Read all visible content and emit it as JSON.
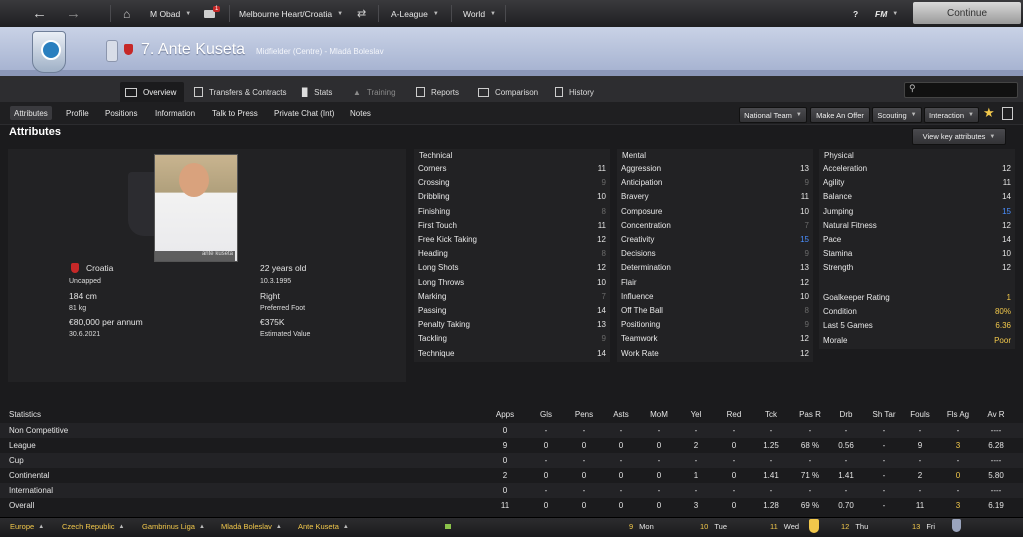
{
  "topbar": {
    "manager": "M Obad",
    "mail_count": "1",
    "club": "Melbourne Heart/Croatia",
    "competition": "A-League",
    "world": "World",
    "help": "?",
    "fm": "FM",
    "continue": "Continue"
  },
  "player": {
    "title": "7. Ante Kuseta",
    "subtitle": "Midfielder (Centre) - Mladá Boleslav",
    "photo_caption": "ante kuseta",
    "nation": "Croatia",
    "age": "22 years old",
    "caps": "Uncapped",
    "dob": "10.3.1995",
    "height": "184 cm",
    "foot": "Right",
    "weight": "81 kg",
    "foot_label": "Preferred Foot",
    "wage": "€80,000 per annum",
    "value": "€375K",
    "contract": "30.6.2021",
    "value_label": "Estimated Value"
  },
  "tabs": [
    {
      "label": "Overview"
    },
    {
      "label": "Transfers & Contracts"
    },
    {
      "label": "Stats"
    },
    {
      "label": "Training"
    },
    {
      "label": "Reports"
    },
    {
      "label": "Comparison"
    },
    {
      "label": "History"
    }
  ],
  "subnav": [
    "Attributes",
    "Profile",
    "Positions",
    "Information",
    "Talk to Press",
    "Private Chat (Int)",
    "Notes"
  ],
  "actions": {
    "national_team": "National Team",
    "make_offer": "Make An Offer",
    "scouting": "Scouting",
    "interaction": "Interaction",
    "view_key": "View key attributes"
  },
  "section_title": "Attributes",
  "colors": {
    "accent": "#f2c84b",
    "highlight": "#4a8fff",
    "low": "#6a6a6a"
  },
  "technical": {
    "header": "Technical",
    "items": [
      {
        "label": "Corners",
        "value": "11"
      },
      {
        "label": "Crossing",
        "value": "9"
      },
      {
        "label": "Dribbling",
        "value": "10"
      },
      {
        "label": "Finishing",
        "value": "8"
      },
      {
        "label": "First Touch",
        "value": "11"
      },
      {
        "label": "Free Kick Taking",
        "value": "12"
      },
      {
        "label": "Heading",
        "value": "8"
      },
      {
        "label": "Long Shots",
        "value": "12"
      },
      {
        "label": "Long Throws",
        "value": "10"
      },
      {
        "label": "Marking",
        "value": "7"
      },
      {
        "label": "Passing",
        "value": "14"
      },
      {
        "label": "Penalty Taking",
        "value": "13"
      },
      {
        "label": "Tackling",
        "value": "9"
      },
      {
        "label": "Technique",
        "value": "14"
      }
    ]
  },
  "mental": {
    "header": "Mental",
    "items": [
      {
        "label": "Aggression",
        "value": "13"
      },
      {
        "label": "Anticipation",
        "value": "9"
      },
      {
        "label": "Bravery",
        "value": "11"
      },
      {
        "label": "Composure",
        "value": "10"
      },
      {
        "label": "Concentration",
        "value": "7"
      },
      {
        "label": "Creativity",
        "value": "15"
      },
      {
        "label": "Decisions",
        "value": "9"
      },
      {
        "label": "Determination",
        "value": "13"
      },
      {
        "label": "Flair",
        "value": "12"
      },
      {
        "label": "Influence",
        "value": "10"
      },
      {
        "label": "Off The Ball",
        "value": "8"
      },
      {
        "label": "Positioning",
        "value": "9"
      },
      {
        "label": "Teamwork",
        "value": "12"
      },
      {
        "label": "Work Rate",
        "value": "12"
      }
    ]
  },
  "physical": {
    "header": "Physical",
    "items": [
      {
        "label": "Acceleration",
        "value": "12"
      },
      {
        "label": "Agility",
        "value": "11"
      },
      {
        "label": "Balance",
        "value": "14"
      },
      {
        "label": "Jumping",
        "value": "15"
      },
      {
        "label": "Natural Fitness",
        "value": "12"
      },
      {
        "label": "Pace",
        "value": "14"
      },
      {
        "label": "Stamina",
        "value": "10"
      },
      {
        "label": "Strength",
        "value": "12"
      }
    ],
    "extra": [
      {
        "label": "Goalkeeper Rating",
        "value": "1"
      },
      {
        "label": "Condition",
        "value": "80%"
      },
      {
        "label": "Last 5 Games",
        "value": "6.36"
      },
      {
        "label": "Morale",
        "value": "Poor"
      }
    ]
  },
  "stats": {
    "header": "Statistics",
    "columns": [
      "Apps",
      "Gls",
      "Pens",
      "Asts",
      "MoM",
      "Yel",
      "Red",
      "Tck",
      "Pas R",
      "Drb",
      "Sh Tar",
      "Fouls",
      "Fls Ag",
      "Av R"
    ],
    "rows": [
      {
        "label": "Non Competitive",
        "values": [
          "0",
          "-",
          "-",
          "-",
          "-",
          "-",
          "-",
          "-",
          "-",
          "-",
          "-",
          "-",
          "-",
          "----"
        ]
      },
      {
        "label": "League",
        "values": [
          "9",
          "0",
          "0",
          "0",
          "0",
          "2",
          "0",
          "1.25",
          "68 %",
          "0.56",
          "-",
          "9",
          "3",
          "6.28"
        ]
      },
      {
        "label": "Cup",
        "values": [
          "0",
          "-",
          "-",
          "-",
          "-",
          "-",
          "-",
          "-",
          "-",
          "-",
          "-",
          "-",
          "-",
          "----"
        ]
      },
      {
        "label": "Continental",
        "values": [
          "2",
          "0",
          "0",
          "0",
          "0",
          "1",
          "0",
          "1.41",
          "71 %",
          "1.41",
          "-",
          "2",
          "0",
          "5.80"
        ]
      },
      {
        "label": "International",
        "values": [
          "0",
          "-",
          "-",
          "-",
          "-",
          "-",
          "-",
          "-",
          "-",
          "-",
          "-",
          "-",
          "-",
          "----"
        ]
      },
      {
        "label": "Overall",
        "values": [
          "11",
          "0",
          "0",
          "0",
          "0",
          "3",
          "0",
          "1.28",
          "69 %",
          "0.70",
          "-",
          "11",
          "3",
          "6.19"
        ]
      }
    ]
  },
  "footer": {
    "crumbs": [
      "Europe",
      "Czech Republic",
      "Gambrinus Liga",
      "Mladá Boleslav",
      "Ante Kuseta"
    ],
    "days": [
      {
        "num": "9",
        "day": "Mon"
      },
      {
        "num": "10",
        "day": "Tue"
      },
      {
        "num": "11",
        "day": "Wed"
      },
      {
        "num": "12",
        "day": "Thu"
      },
      {
        "num": "13",
        "day": "Fri"
      }
    ]
  }
}
